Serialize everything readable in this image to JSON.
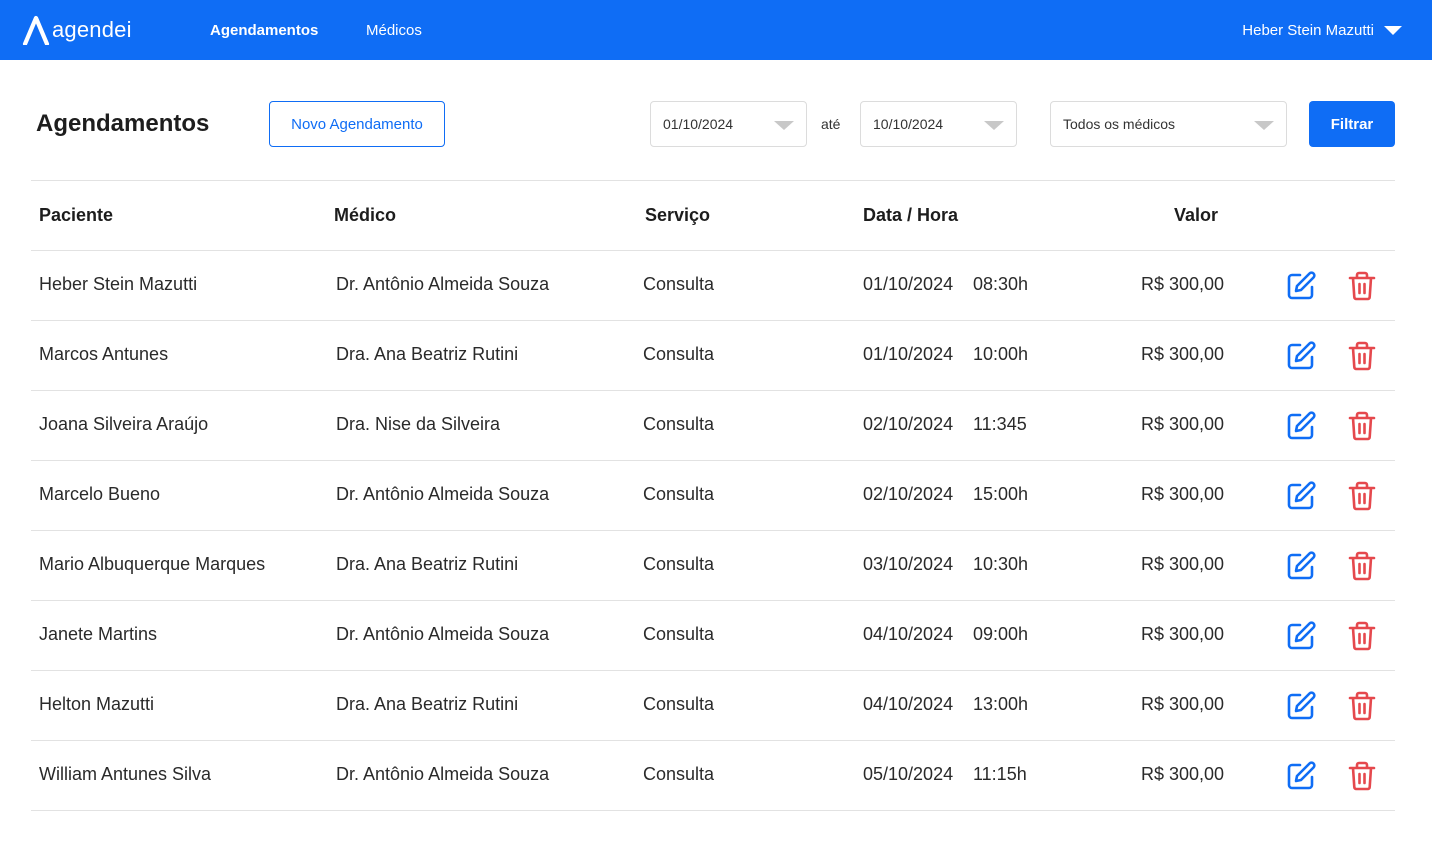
{
  "app": {
    "logo_text": "agendei"
  },
  "nav": {
    "appointments": "Agendamentos",
    "doctors": "Médicos"
  },
  "user": {
    "name": "Heber Stein Mazutti"
  },
  "header": {
    "title": "Agendamentos",
    "new_button": "Novo Agendamento",
    "date_start": "01/10/2024",
    "date_separator": "até",
    "date_end": "10/10/2024",
    "doctor_filter": "Todos os médicos",
    "filter_button": "Filtrar"
  },
  "table": {
    "columns": [
      "Paciente",
      "Médico",
      "Serviço",
      "Data / Hora",
      "Valor"
    ],
    "rows": [
      {
        "patient": "Heber Stein Mazutti",
        "doctor": "Dr. Antônio Almeida Souza",
        "service": "Consulta",
        "date": "01/10/2024",
        "time": "08:30h",
        "value": "R$ 300,00"
      },
      {
        "patient": "Marcos Antunes",
        "doctor": "Dra. Ana Beatriz Rutini",
        "service": "Consulta",
        "date": "01/10/2024",
        "time": "10:00h",
        "value": "R$ 300,00"
      },
      {
        "patient": "Joana Silveira Araújo",
        "doctor": "Dra. Nise da Silveira",
        "service": "Consulta",
        "date": "02/10/2024",
        "time": "11:345",
        "value": "R$ 300,00"
      },
      {
        "patient": "Marcelo Bueno",
        "doctor": "Dr. Antônio Almeida Souza",
        "service": "Consulta",
        "date": "02/10/2024",
        "time": "15:00h",
        "value": "R$ 300,00"
      },
      {
        "patient": "Mario Albuquerque Marques",
        "doctor": "Dra. Ana Beatriz Rutini",
        "service": "Consulta",
        "date": "03/10/2024",
        "time": "10:30h",
        "value": "R$ 300,00"
      },
      {
        "patient": "Janete Martins",
        "doctor": "Dr. Antônio Almeida Souza",
        "service": "Consulta",
        "date": "04/10/2024",
        "time": "09:00h",
        "value": "R$ 300,00"
      },
      {
        "patient": "Helton Mazutti",
        "doctor": "Dra. Ana Beatriz Rutini",
        "service": "Consulta",
        "date": "04/10/2024",
        "time": "13:00h",
        "value": "R$ 300,00"
      },
      {
        "patient": "William Antunes Silva",
        "doctor": "Dr. Antônio Almeida Souza",
        "service": "Consulta",
        "date": "05/10/2024",
        "time": "11:15h",
        "value": "R$ 300,00"
      }
    ],
    "row_icons": [
      "edit-icon",
      "trash-icon"
    ]
  },
  "colors": {
    "primary": "#0f6df5",
    "danger": "#e5484d",
    "border": "#e2e2e2"
  }
}
